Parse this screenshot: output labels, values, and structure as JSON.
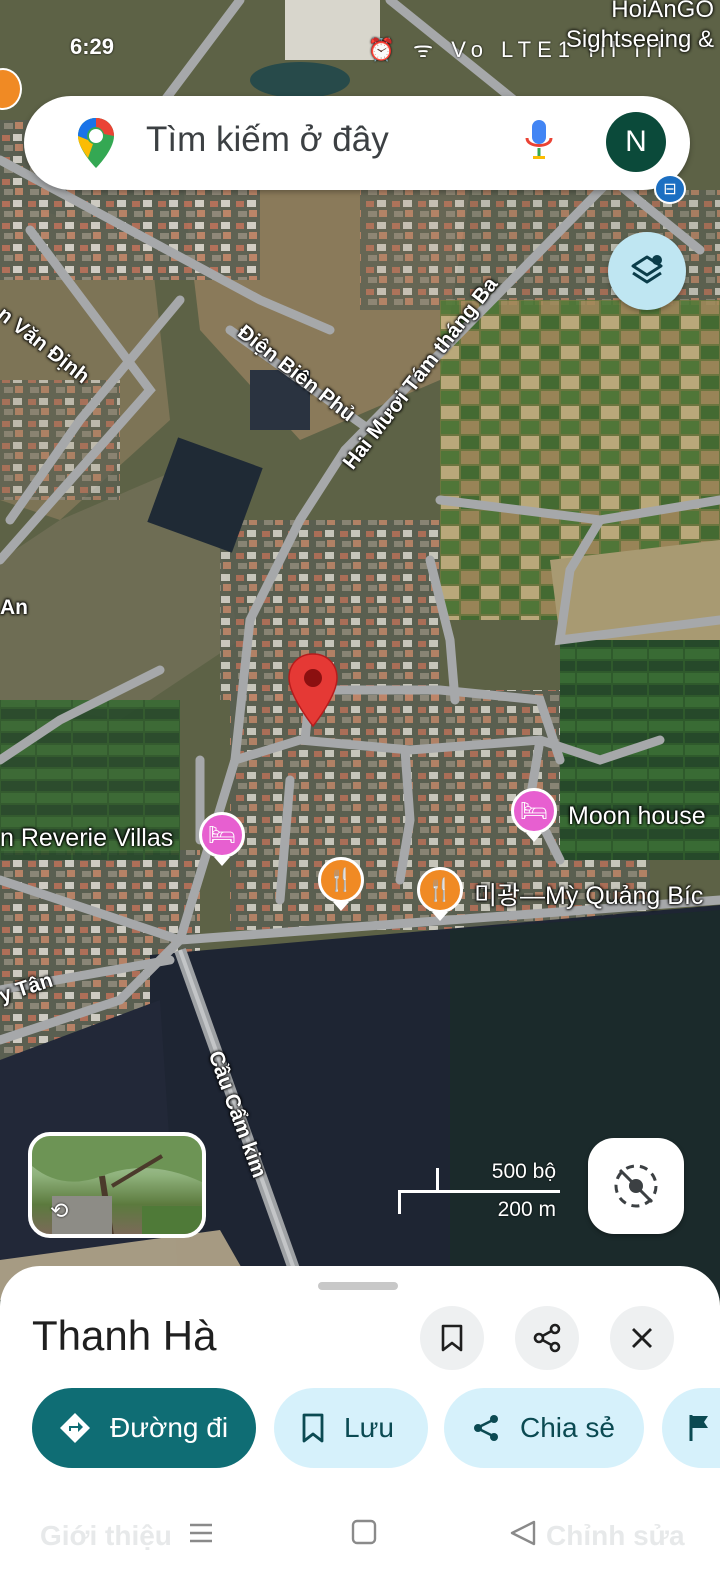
{
  "status_bar": {
    "time": "6:29",
    "icons_text": "⏰ ᯤ Vo LTE1 ıll ıll",
    "corner_line1": "HoiAnGO",
    "corner_line2": "Sightseeing &"
  },
  "search": {
    "placeholder": "Tìm kiếm ở đây",
    "avatar_letter": "N",
    "icon": "google-maps-pin-icon"
  },
  "map": {
    "type": "satellite",
    "road_labels": [
      "n Văn Định",
      "Điện Biên Phủ",
      "Hai Mươi Tám tháng Ba",
      "An",
      "y Tân",
      "Cầu Cẩm kim"
    ],
    "pois": [
      {
        "name": "n Reverie Villas",
        "kind": "hotel",
        "icon": "bed-icon"
      },
      {
        "name": "Moon house",
        "kind": "hotel",
        "icon": "bed-icon"
      },
      {
        "name": "",
        "kind": "restaurant",
        "icon": "fork-knife-icon"
      },
      {
        "name": "미광—Mỳ Quảng Bíc",
        "kind": "restaurant",
        "icon": "fork-knife-icon"
      }
    ],
    "scale": {
      "imperial": "500 bộ",
      "metric": "200 m"
    },
    "colors": {
      "pin": "#e53935",
      "hotel_poi": "#e75fd0",
      "food_poi": "#f08a24"
    }
  },
  "place_sheet": {
    "title": "Thanh Hà",
    "actions": {
      "directions": "Đường đi",
      "save": "Lưu",
      "share": "Chia sẻ"
    },
    "colors": {
      "primary": "#0f6d74",
      "chip": "#d6f1fb"
    }
  },
  "system_nav": {
    "left_faint": "Giới thiệu",
    "right_faint": "Chỉnh sửa"
  }
}
